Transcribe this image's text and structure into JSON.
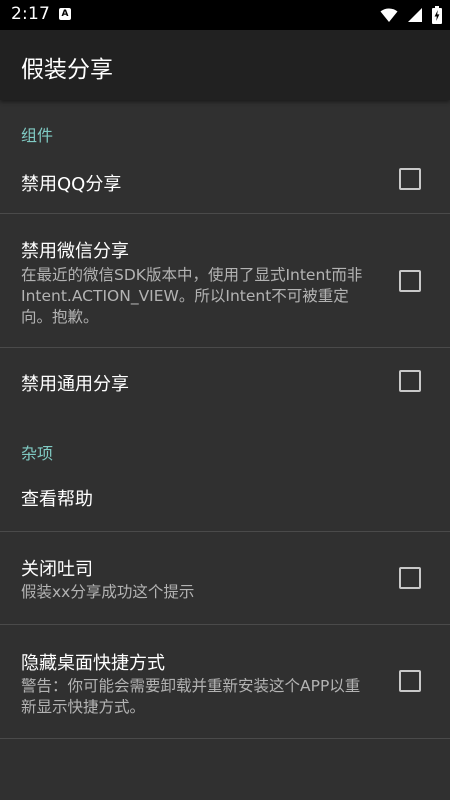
{
  "status_bar": {
    "time": "2:17",
    "notification_icon": "a-icon"
  },
  "app_bar": {
    "title": "假装分享"
  },
  "sections": [
    {
      "header": "组件",
      "items": [
        {
          "title": "禁用QQ分享",
          "summary": "",
          "checked": false
        },
        {
          "title": "禁用微信分享",
          "summary": "在最近的微信SDK版本中，使用了显式Intent而非Intent.ACTION_VIEW。所以Intent不可被重定向。抱歉。",
          "checked": false
        },
        {
          "title": "禁用通用分享",
          "summary": "",
          "checked": false
        }
      ]
    },
    {
      "header": "杂项",
      "items": [
        {
          "title": "查看帮助",
          "summary": ""
        },
        {
          "title": "关闭吐司",
          "summary": "假装xx分享成功这个提示",
          "checked": false
        },
        {
          "title": "隐藏桌面快捷方式",
          "summary": "警告：你可能会需要卸载并重新安装这个APP以重新显示快捷方式。",
          "checked": false
        }
      ]
    }
  ],
  "colors": {
    "background": "#303030",
    "app_bar": "#212121",
    "category_accent": "#80cbc4",
    "summary_text": "#b3b3b3"
  }
}
